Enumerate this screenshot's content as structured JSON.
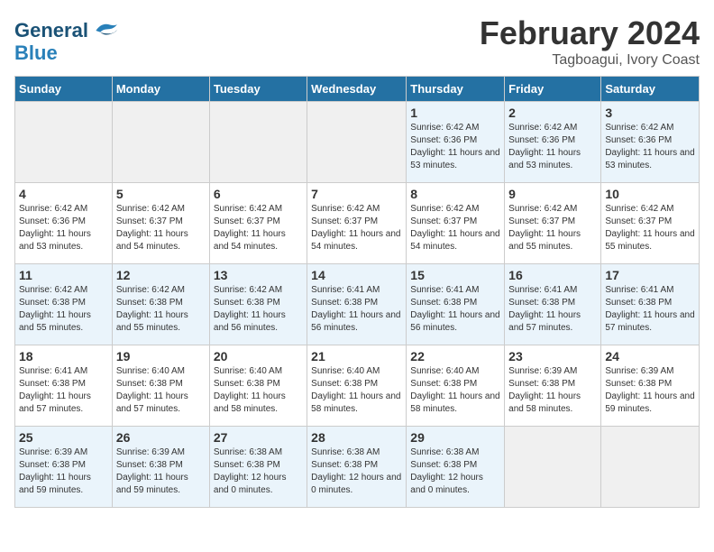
{
  "header": {
    "logo_line1": "General",
    "logo_line2": "Blue",
    "month": "February 2024",
    "location": "Tagboagui, Ivory Coast"
  },
  "weekdays": [
    "Sunday",
    "Monday",
    "Tuesday",
    "Wednesday",
    "Thursday",
    "Friday",
    "Saturday"
  ],
  "weeks": [
    [
      {
        "day": "",
        "sunrise": "",
        "sunset": "",
        "daylight": ""
      },
      {
        "day": "",
        "sunrise": "",
        "sunset": "",
        "daylight": ""
      },
      {
        "day": "",
        "sunrise": "",
        "sunset": "",
        "daylight": ""
      },
      {
        "day": "",
        "sunrise": "",
        "sunset": "",
        "daylight": ""
      },
      {
        "day": "1",
        "sunrise": "Sunrise: 6:42 AM",
        "sunset": "Sunset: 6:36 PM",
        "daylight": "Daylight: 11 hours and 53 minutes."
      },
      {
        "day": "2",
        "sunrise": "Sunrise: 6:42 AM",
        "sunset": "Sunset: 6:36 PM",
        "daylight": "Daylight: 11 hours and 53 minutes."
      },
      {
        "day": "3",
        "sunrise": "Sunrise: 6:42 AM",
        "sunset": "Sunset: 6:36 PM",
        "daylight": "Daylight: 11 hours and 53 minutes."
      }
    ],
    [
      {
        "day": "4",
        "sunrise": "Sunrise: 6:42 AM",
        "sunset": "Sunset: 6:36 PM",
        "daylight": "Daylight: 11 hours and 53 minutes."
      },
      {
        "day": "5",
        "sunrise": "Sunrise: 6:42 AM",
        "sunset": "Sunset: 6:37 PM",
        "daylight": "Daylight: 11 hours and 54 minutes."
      },
      {
        "day": "6",
        "sunrise": "Sunrise: 6:42 AM",
        "sunset": "Sunset: 6:37 PM",
        "daylight": "Daylight: 11 hours and 54 minutes."
      },
      {
        "day": "7",
        "sunrise": "Sunrise: 6:42 AM",
        "sunset": "Sunset: 6:37 PM",
        "daylight": "Daylight: 11 hours and 54 minutes."
      },
      {
        "day": "8",
        "sunrise": "Sunrise: 6:42 AM",
        "sunset": "Sunset: 6:37 PM",
        "daylight": "Daylight: 11 hours and 54 minutes."
      },
      {
        "day": "9",
        "sunrise": "Sunrise: 6:42 AM",
        "sunset": "Sunset: 6:37 PM",
        "daylight": "Daylight: 11 hours and 55 minutes."
      },
      {
        "day": "10",
        "sunrise": "Sunrise: 6:42 AM",
        "sunset": "Sunset: 6:37 PM",
        "daylight": "Daylight: 11 hours and 55 minutes."
      }
    ],
    [
      {
        "day": "11",
        "sunrise": "Sunrise: 6:42 AM",
        "sunset": "Sunset: 6:38 PM",
        "daylight": "Daylight: 11 hours and 55 minutes."
      },
      {
        "day": "12",
        "sunrise": "Sunrise: 6:42 AM",
        "sunset": "Sunset: 6:38 PM",
        "daylight": "Daylight: 11 hours and 55 minutes."
      },
      {
        "day": "13",
        "sunrise": "Sunrise: 6:42 AM",
        "sunset": "Sunset: 6:38 PM",
        "daylight": "Daylight: 11 hours and 56 minutes."
      },
      {
        "day": "14",
        "sunrise": "Sunrise: 6:41 AM",
        "sunset": "Sunset: 6:38 PM",
        "daylight": "Daylight: 11 hours and 56 minutes."
      },
      {
        "day": "15",
        "sunrise": "Sunrise: 6:41 AM",
        "sunset": "Sunset: 6:38 PM",
        "daylight": "Daylight: 11 hours and 56 minutes."
      },
      {
        "day": "16",
        "sunrise": "Sunrise: 6:41 AM",
        "sunset": "Sunset: 6:38 PM",
        "daylight": "Daylight: 11 hours and 57 minutes."
      },
      {
        "day": "17",
        "sunrise": "Sunrise: 6:41 AM",
        "sunset": "Sunset: 6:38 PM",
        "daylight": "Daylight: 11 hours and 57 minutes."
      }
    ],
    [
      {
        "day": "18",
        "sunrise": "Sunrise: 6:41 AM",
        "sunset": "Sunset: 6:38 PM",
        "daylight": "Daylight: 11 hours and 57 minutes."
      },
      {
        "day": "19",
        "sunrise": "Sunrise: 6:40 AM",
        "sunset": "Sunset: 6:38 PM",
        "daylight": "Daylight: 11 hours and 57 minutes."
      },
      {
        "day": "20",
        "sunrise": "Sunrise: 6:40 AM",
        "sunset": "Sunset: 6:38 PM",
        "daylight": "Daylight: 11 hours and 58 minutes."
      },
      {
        "day": "21",
        "sunrise": "Sunrise: 6:40 AM",
        "sunset": "Sunset: 6:38 PM",
        "daylight": "Daylight: 11 hours and 58 minutes."
      },
      {
        "day": "22",
        "sunrise": "Sunrise: 6:40 AM",
        "sunset": "Sunset: 6:38 PM",
        "daylight": "Daylight: 11 hours and 58 minutes."
      },
      {
        "day": "23",
        "sunrise": "Sunrise: 6:39 AM",
        "sunset": "Sunset: 6:38 PM",
        "daylight": "Daylight: 11 hours and 58 minutes."
      },
      {
        "day": "24",
        "sunrise": "Sunrise: 6:39 AM",
        "sunset": "Sunset: 6:38 PM",
        "daylight": "Daylight: 11 hours and 59 minutes."
      }
    ],
    [
      {
        "day": "25",
        "sunrise": "Sunrise: 6:39 AM",
        "sunset": "Sunset: 6:38 PM",
        "daylight": "Daylight: 11 hours and 59 minutes."
      },
      {
        "day": "26",
        "sunrise": "Sunrise: 6:39 AM",
        "sunset": "Sunset: 6:38 PM",
        "daylight": "Daylight: 11 hours and 59 minutes."
      },
      {
        "day": "27",
        "sunrise": "Sunrise: 6:38 AM",
        "sunset": "Sunset: 6:38 PM",
        "daylight": "Daylight: 12 hours and 0 minutes."
      },
      {
        "day": "28",
        "sunrise": "Sunrise: 6:38 AM",
        "sunset": "Sunset: 6:38 PM",
        "daylight": "Daylight: 12 hours and 0 minutes."
      },
      {
        "day": "29",
        "sunrise": "Sunrise: 6:38 AM",
        "sunset": "Sunset: 6:38 PM",
        "daylight": "Daylight: 12 hours and 0 minutes."
      },
      {
        "day": "",
        "sunrise": "",
        "sunset": "",
        "daylight": ""
      },
      {
        "day": "",
        "sunrise": "",
        "sunset": "",
        "daylight": ""
      }
    ]
  ]
}
